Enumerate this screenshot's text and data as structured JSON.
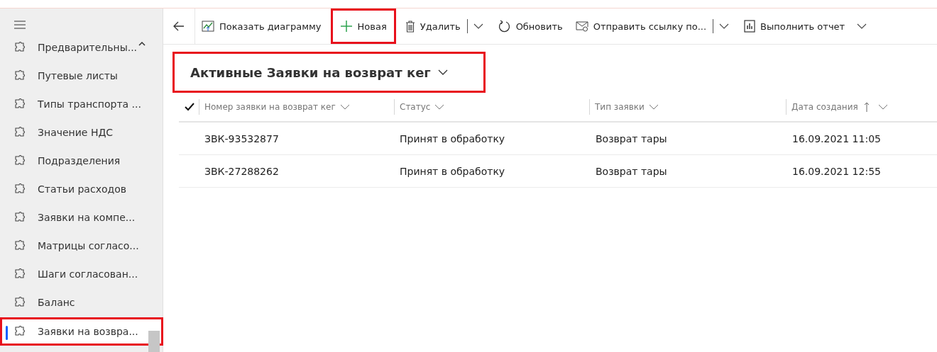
{
  "sidebar": {
    "items": [
      {
        "label": "Предварительны...",
        "selected": false,
        "highlighted": false,
        "collapse": true
      },
      {
        "label": "Путевые листы",
        "selected": false,
        "highlighted": false
      },
      {
        "label": "Типы транспорта ...",
        "selected": false,
        "highlighted": false
      },
      {
        "label": "Значение НДС",
        "selected": false,
        "highlighted": false
      },
      {
        "label": "Подразделения",
        "selected": false,
        "highlighted": false
      },
      {
        "label": "Статьи расходов",
        "selected": false,
        "highlighted": false
      },
      {
        "label": "Заявки на компе...",
        "selected": false,
        "highlighted": false
      },
      {
        "label": "Матрицы согласо...",
        "selected": false,
        "highlighted": false
      },
      {
        "label": "Шаги согласован...",
        "selected": false,
        "highlighted": false
      },
      {
        "label": "Баланс",
        "selected": false,
        "highlighted": false
      },
      {
        "label": "Заявки на возвра...",
        "selected": true,
        "highlighted": true
      }
    ]
  },
  "toolbar": [
    {
      "kind": "chart",
      "label": "Показать диаграмму",
      "highlighted": false
    },
    {
      "kind": "new",
      "label": "Новая",
      "highlighted": true
    },
    {
      "kind": "delete",
      "label": "Удалить",
      "highlighted": false,
      "split": true
    },
    {
      "kind": "refresh",
      "label": "Обновить",
      "highlighted": false
    },
    {
      "kind": "mail",
      "label": "Отправить ссылку по...",
      "highlighted": false,
      "split": true
    },
    {
      "kind": "report",
      "label": "Выполнить отчет",
      "highlighted": false,
      "dropdown": true
    }
  ],
  "view": {
    "title": "Активные Заявки на возврат кег",
    "highlighted": true
  },
  "table": {
    "columns": [
      {
        "label": "Номер заявки на возврат кег",
        "sorted": false
      },
      {
        "label": "Статус",
        "sorted": false
      },
      {
        "label": "Тип заявки",
        "sorted": false
      },
      {
        "label": "Дата создания",
        "sorted": true
      }
    ],
    "rows": [
      [
        "ЗВК-93532877",
        "Принят в обработку",
        "Возврат тары",
        "16.09.2021 11:05"
      ],
      [
        "ЗВК-27288262",
        "Принят в обработку",
        "Возврат тары",
        "16.09.2021 12:55"
      ]
    ]
  }
}
